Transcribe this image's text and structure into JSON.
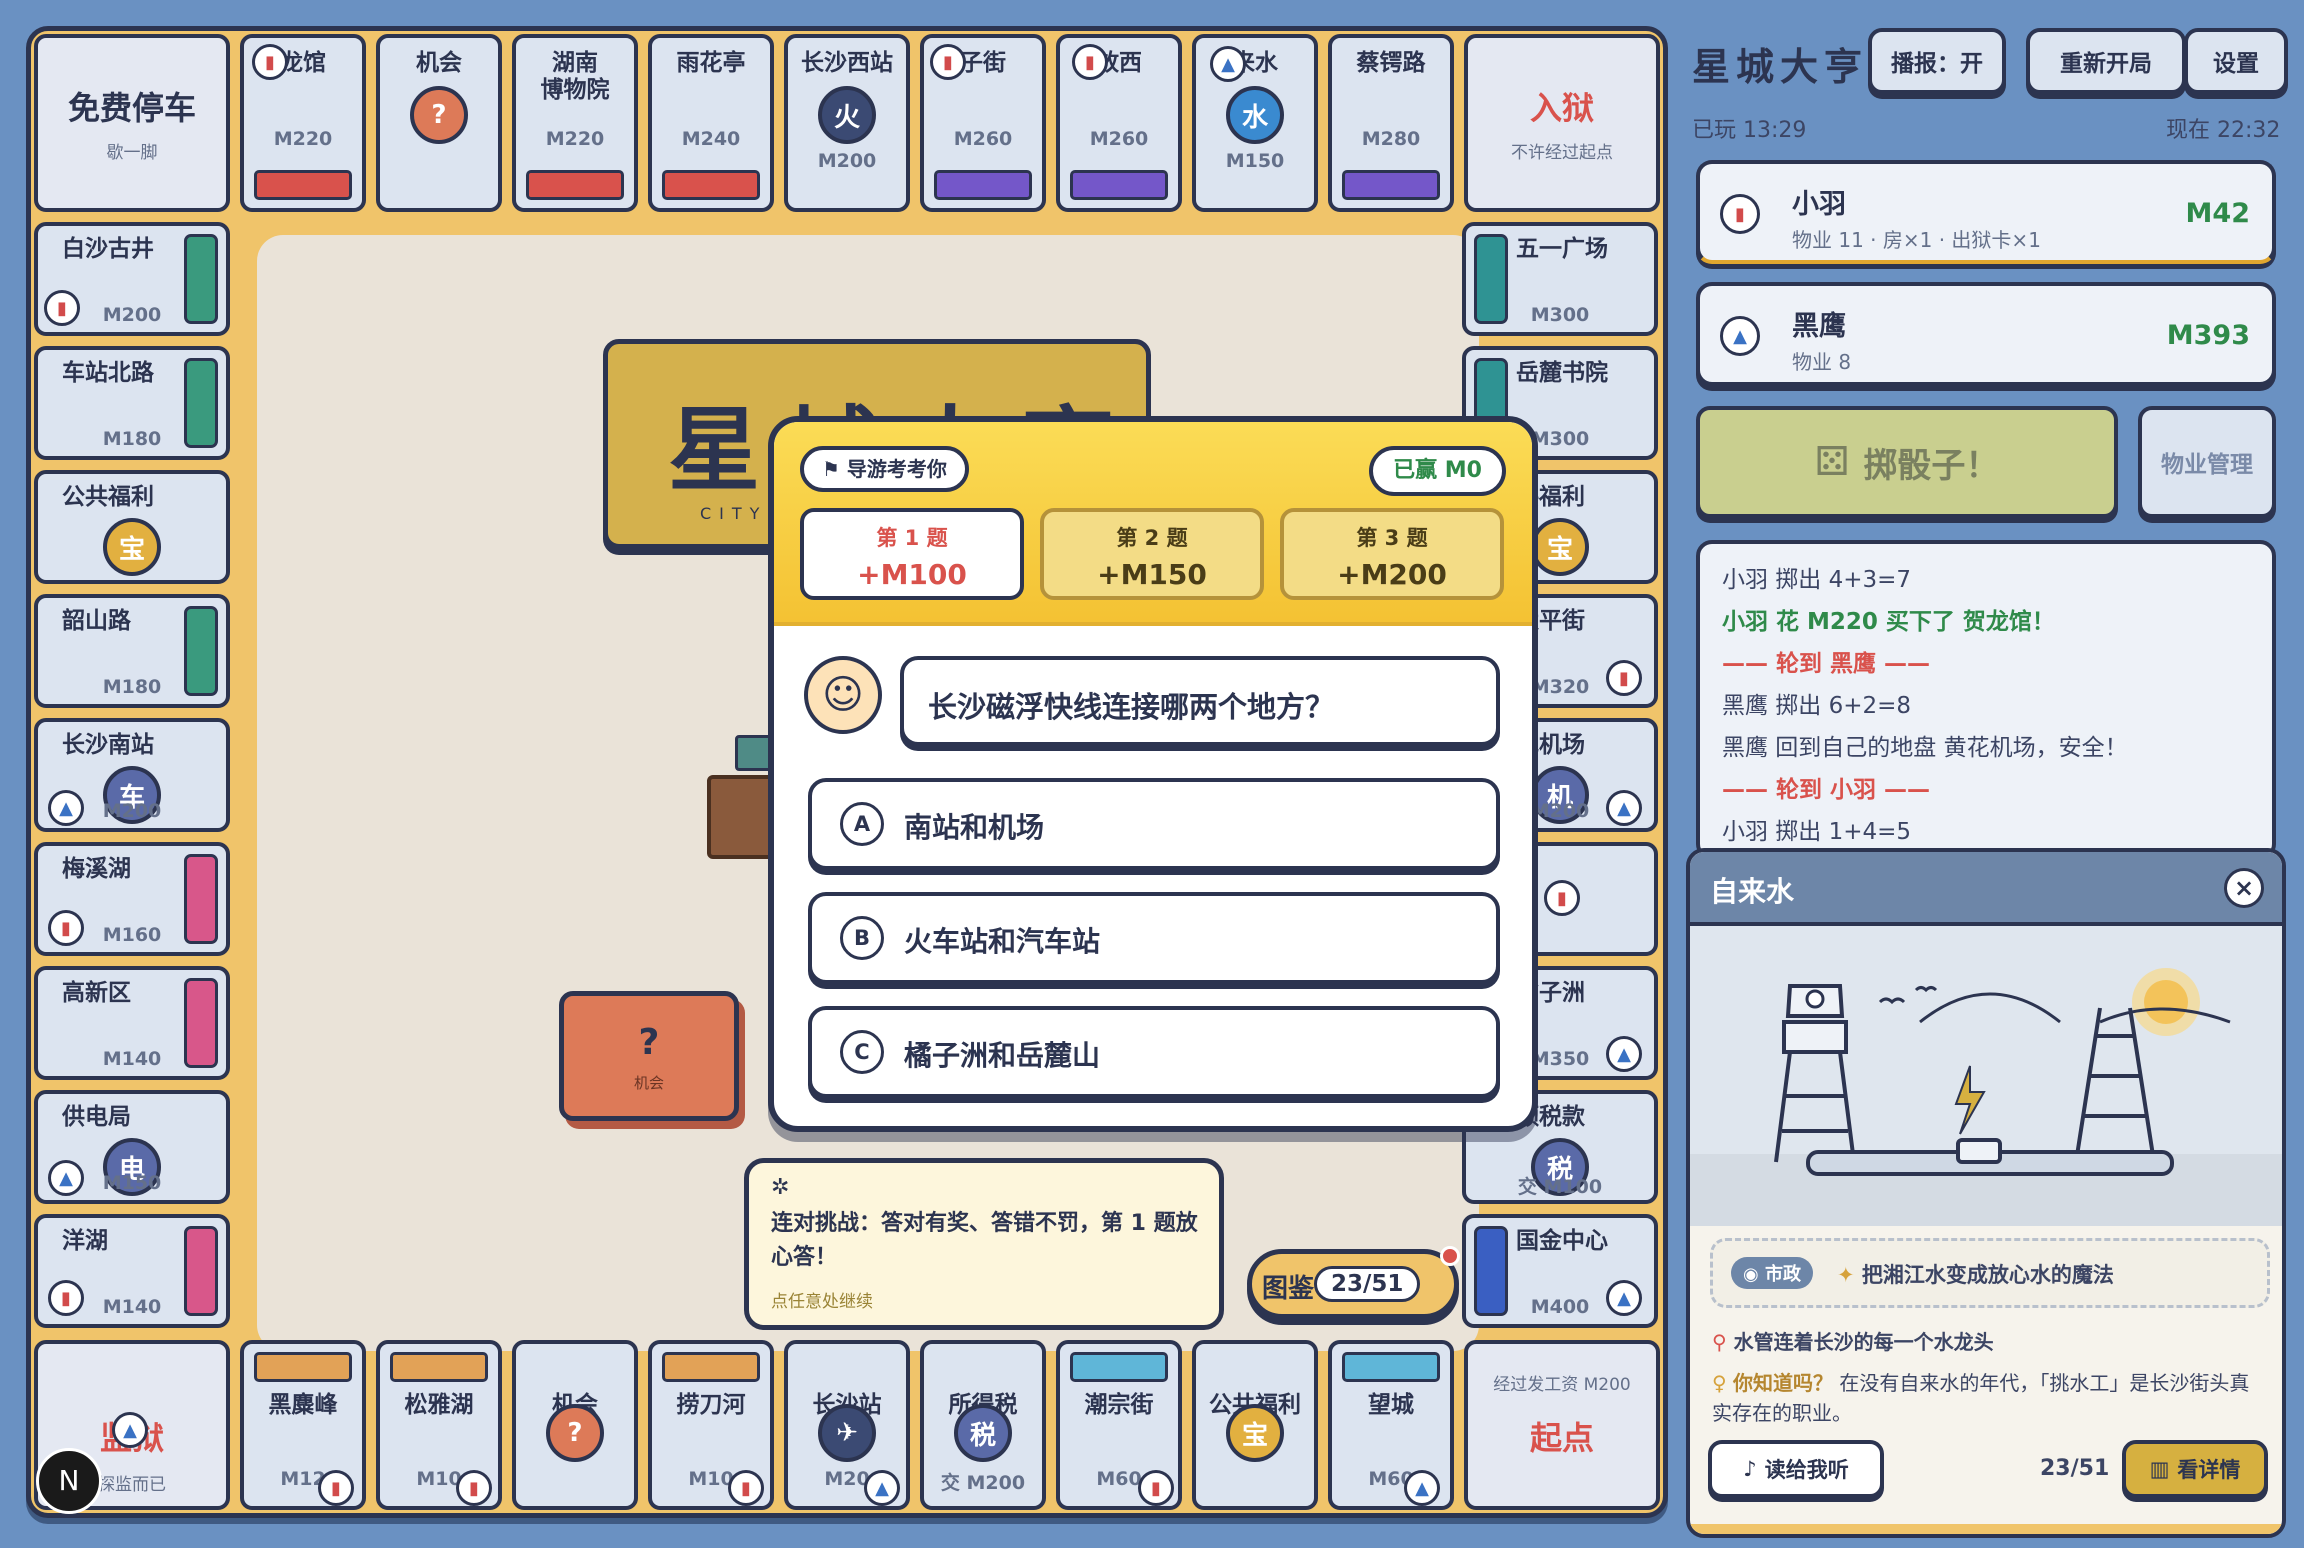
{
  "board": {
    "top": [
      {
        "name": "免费停车",
        "sub": "歇一脚"
      },
      {
        "name": "龙馆",
        "price": "M220",
        "color": "#d9524c"
      },
      {
        "name": "机会",
        "glyph": "?"
      },
      {
        "name": "湖南\n博物院",
        "price": "M220",
        "color": "#d9524c"
      },
      {
        "name": "雨花亭",
        "price": "M240",
        "color": "#d9524c"
      },
      {
        "name": "长沙西站",
        "price": "M200",
        "glyph": "火"
      },
      {
        "name": "子街",
        "price": "M260",
        "color": "#7457c9"
      },
      {
        "name": "放西",
        "price": "M260",
        "color": "#7457c9"
      },
      {
        "name": "来水",
        "price": "M150",
        "glyph": "水"
      },
      {
        "name": "蔡锷路",
        "price": "M280",
        "color": "#7457c9"
      },
      {
        "name": "入狱",
        "sub": "不许经过起点"
      }
    ],
    "left": [
      {
        "name": "白沙古井",
        "price": "M200",
        "color": "#3a9a7e"
      },
      {
        "name": "车站北路",
        "price": "M180",
        "color": "#3a9a7e"
      },
      {
        "name": "公共福利",
        "glyph": "宝"
      },
      {
        "name": "韶山路",
        "price": "M180",
        "color": "#3a9a7e"
      },
      {
        "name": "长沙南站",
        "price": "M200",
        "glyph": "车"
      },
      {
        "name": "梅溪湖",
        "price": "M160",
        "color": "#d8578a"
      },
      {
        "name": "高新区",
        "price": "M140",
        "color": "#d8578a"
      },
      {
        "name": "供电局",
        "price": "M150",
        "glyph": "电"
      },
      {
        "name": "洋湖",
        "price": "M140",
        "color": "#d8578a"
      }
    ],
    "right": [
      {
        "name": "五一广场",
        "price": "M300",
        "color": "#2f9393"
      },
      {
        "name": "岳麓书院",
        "price": "M300",
        "color": "#2f9393"
      },
      {
        "name": "共福利",
        "glyph": "宝"
      },
      {
        "name": "太平街",
        "price": "M320"
      },
      {
        "name": "花机场",
        "price": "M200",
        "glyph": "机"
      },
      {
        "name": "",
        "price": ""
      },
      {
        "name": "橘子洲",
        "price": "M350"
      },
      {
        "name": "额税款",
        "price": "交 M100",
        "glyph": "税"
      },
      {
        "name": "国金中心",
        "price": "M400",
        "color": "#3a5fc2"
      }
    ],
    "bottom": [
      {
        "name": "监狱",
        "sub": "探监而已"
      },
      {
        "name": "黑麋峰",
        "price": "M12",
        "color": "#e2a257"
      },
      {
        "name": "松雅湖",
        "price": "M10",
        "color": "#e2a257"
      },
      {
        "name": "机会",
        "glyph": "?"
      },
      {
        "name": "捞刀河",
        "price": "M10",
        "color": "#e2a257"
      },
      {
        "name": "长沙站",
        "price": "M20",
        "glyph": "✈"
      },
      {
        "name": "所得税",
        "price": "交 M200",
        "glyph": "税"
      },
      {
        "name": "潮宗街",
        "price": "M60",
        "color": "#5fb6d8"
      },
      {
        "name": "公共福利",
        "glyph": "宝"
      },
      {
        "name": "望城",
        "price": "M60",
        "color": "#5fb6d8"
      },
      {
        "name": "起点",
        "sub": "经过发工资 M200"
      }
    ],
    "center_title": "星城大亨",
    "center_sub": "CITY TY",
    "chance_deck": "机会",
    "atlas_label": "图鉴",
    "atlas_count": "23/51"
  },
  "header": {
    "title": "星城大亨",
    "broadcast": "播报：开",
    "restart": "重新开局",
    "settings": "设置",
    "played": "已玩 13:29",
    "now": "现在 22:32"
  },
  "players": [
    {
      "name": "小羽",
      "meta": "物业 11 · 房×1 · 出狱卡×1",
      "money": "M42"
    },
    {
      "name": "黑鹰",
      "meta": "物业 8",
      "money": "M393"
    }
  ],
  "actions": {
    "roll": "掷骰子！",
    "property": "物业管理"
  },
  "log": [
    {
      "text": "小羽 掷出 4+3=7",
      "style": "normal"
    },
    {
      "text": "小羽 花 M220 买下了 贺龙馆！",
      "style": "green"
    },
    {
      "text": "—— 轮到 黑鹰 ——",
      "style": "turn"
    },
    {
      "text": "黑鹰 掷出 6+2=8",
      "style": "normal"
    },
    {
      "text": "黑鹰 回到自己的地盘 黄花机场，安全！",
      "style": "normal"
    },
    {
      "text": "—— 轮到 小羽 ——",
      "style": "turn"
    },
    {
      "text": "小羽 掷出 1+4=5",
      "style": "normal"
    }
  ],
  "info_card": {
    "title": "自来水",
    "tag": "市政",
    "tagline": "把湘江水变成放心水的魔法",
    "fact1": "水管连着长沙的每一个水龙头",
    "dyk_label": "你知道吗？",
    "dyk_text": "在没有自来水的年代，「挑水工」是长沙街头真实存在的职业。",
    "read": "读给我听",
    "count": "23/51",
    "detail": "看详情"
  },
  "quiz": {
    "badge": "导游考考你",
    "won": "已赢 M0",
    "tabs": [
      {
        "label": "第 1 题",
        "reward": "+M100"
      },
      {
        "label": "第 2 题",
        "reward": "+M150"
      },
      {
        "label": "第 3 题",
        "reward": "+M200"
      }
    ],
    "question": "长沙磁浮快线连接哪两个地方？",
    "options": [
      {
        "key": "A",
        "text": "南站和机场"
      },
      {
        "key": "B",
        "text": "火车站和汽车站"
      },
      {
        "key": "C",
        "text": "橘子洲和岳麓山"
      }
    ]
  },
  "tip": {
    "text": "连对挑战：答对有奖、答错不罚，第 1 题放心答！",
    "hint": "点任意处继续"
  },
  "corner_logo": "N"
}
